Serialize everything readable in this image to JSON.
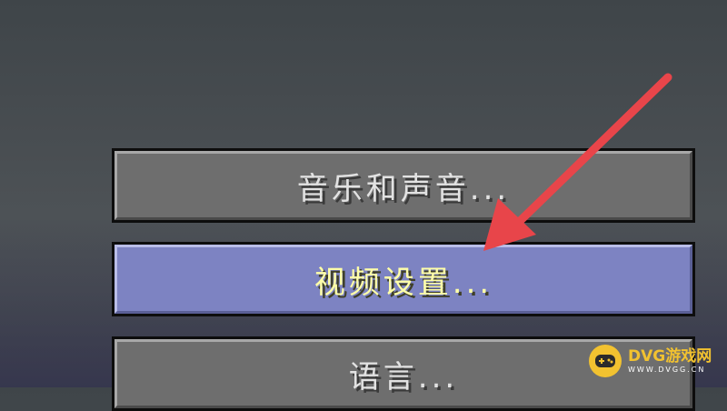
{
  "menu": {
    "buttons": [
      {
        "label": "音乐和声音..."
      },
      {
        "label": "视频设置..."
      },
      {
        "label": "语言..."
      }
    ]
  },
  "colors": {
    "button_normal": "#6e6e6e",
    "button_highlight": "#7d83c2",
    "label_normal": "#e2e2e2",
    "label_highlight": "#ffffa8",
    "arrow": "#e8454a"
  },
  "watermark": {
    "brand": "DVG游戏网",
    "domain": "WWW.DVGG.CN"
  }
}
